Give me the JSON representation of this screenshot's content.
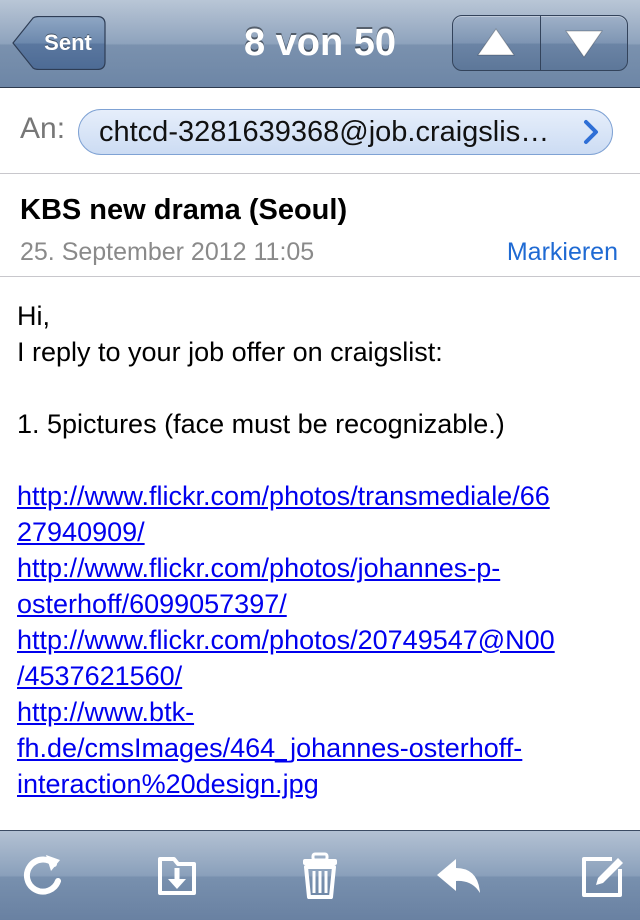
{
  "nav": {
    "back_label": "Sent",
    "title": "8 von 50"
  },
  "to": {
    "label": "An:",
    "recipient": "chtcd-3281639368@job.craigslis…"
  },
  "message": {
    "subject": "KBS new drama (Seoul)",
    "date": "25. September 2012 11:05",
    "mark_label": "Markieren"
  },
  "body": {
    "line1": "Hi,",
    "line2": "I reply to your job offer on craigslist:",
    "line3": "1. 5pictures (face must be recognizable.)",
    "link1": [
      "http://www.flickr.com/photos/transmediale/66",
      "27940909/"
    ],
    "link2": [
      "http://www.flickr.com/photos/johannes-p-",
      "osterhoff/6099057397/"
    ],
    "link3": [
      "http://www.flickr.com/photos/20749547@N00",
      "/4537621560/"
    ],
    "link4": [
      "http://www.btk-",
      "fh.de/cmsImages/464_johannes-osterhoff-",
      "interaction%20design.jpg"
    ]
  },
  "toolbar": {
    "icons": [
      "refresh-icon",
      "move-to-folder-icon",
      "trash-icon",
      "reply-icon",
      "compose-icon"
    ]
  },
  "colors": {
    "link": "#0000ee",
    "accent": "#1f6ad3",
    "nav_bar": "#7a91ae"
  }
}
